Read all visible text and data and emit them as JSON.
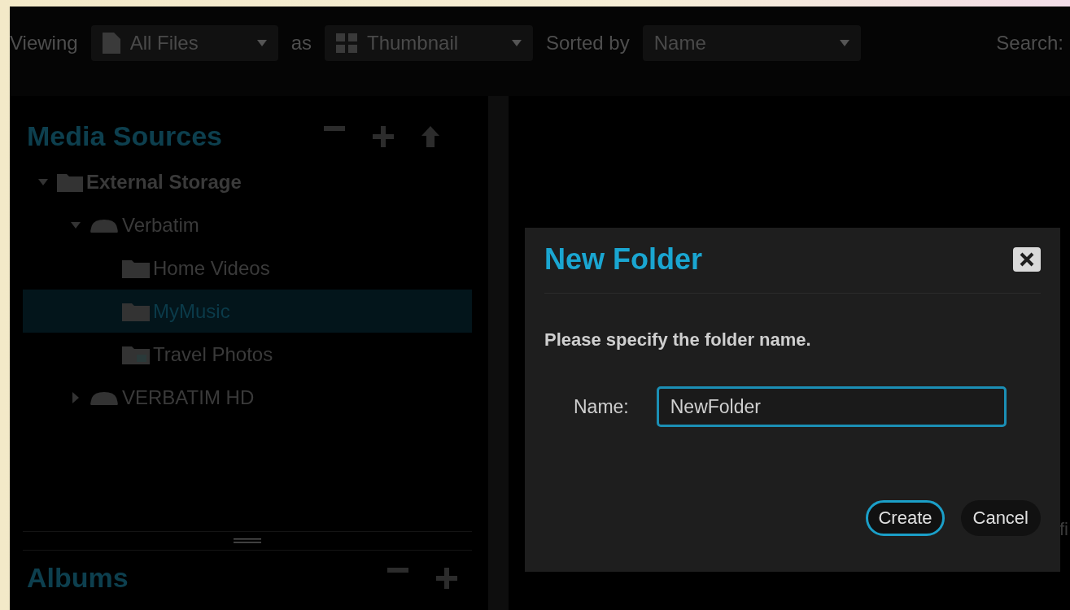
{
  "toolbar": {
    "viewing_label": "Viewing",
    "filter": {
      "value": "All Files"
    },
    "as_label": "as",
    "view": {
      "value": "Thumbnail"
    },
    "sorted_label": "Sorted by",
    "sort": {
      "value": "Name"
    },
    "search_label": "Search:"
  },
  "media_sources": {
    "title": "Media Sources",
    "tree": [
      {
        "label": "External Storage",
        "kind": "storage",
        "expanded": true,
        "selected": false,
        "children": [
          {
            "label": "Verbatim",
            "kind": "drive",
            "expanded": true,
            "selected": false,
            "children": [
              {
                "label": "Home Videos",
                "kind": "folder",
                "selected": false
              },
              {
                "label": "MyMusic",
                "kind": "folder",
                "selected": true
              },
              {
                "label": "Travel Photos",
                "kind": "photo-folder",
                "selected": false
              }
            ]
          },
          {
            "label": "VERBATIM HD",
            "kind": "drive",
            "expanded": false,
            "selected": false
          }
        ]
      }
    ]
  },
  "albums": {
    "title": "Albums"
  },
  "background_text": "fi",
  "dialog": {
    "title": "New Folder",
    "message": "Please specify the folder name.",
    "field_label": "Name:",
    "field_value": "NewFolder",
    "buttons": [
      {
        "label": "Create",
        "selected": true
      },
      {
        "label": "Cancel",
        "selected": false
      }
    ]
  }
}
